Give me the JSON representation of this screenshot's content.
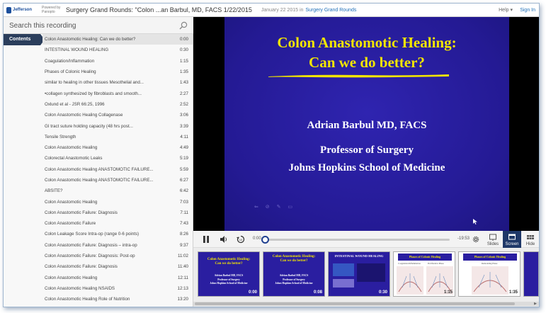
{
  "header": {
    "logo": "Jefferson",
    "powered_by": "Powered by Panopto",
    "title": "Surgery Grand Rounds: \"Colon ...an Barbul, MD, FACS 1/22/2015",
    "date": "January 22 2015 in",
    "folder": "Surgery Grand Rounds",
    "help": "Help",
    "signin": "Sign In"
  },
  "search": {
    "placeholder": "Search this recording"
  },
  "contents_tab": "Contents",
  "toc": [
    {
      "label": "Colon Anastomotic Healing: Can we do better?",
      "time": "0:00"
    },
    {
      "label": "INTESTINAL WOUND HEALING",
      "time": "0:30"
    },
    {
      "label": "Coagulation/Inflammation",
      "time": "1:15"
    },
    {
      "label": "Phases of Colonic Healing",
      "time": "1:35"
    },
    {
      "label": "similar to healing in other tissues Mesothelial and...",
      "time": "1:43"
    },
    {
      "label": "•collagen synthesized by fibroblasts and smooth...",
      "time": "2:27"
    },
    {
      "label": "Oxlund et al - JSR 66:25, 1996",
      "time": "2:52"
    },
    {
      "label": "Colon Anastomotic Healing Collagenase",
      "time": "3:06"
    },
    {
      "label": "GI tract suture holding capacity (48 hrs post...",
      "time": "3:39"
    },
    {
      "label": "Tensile Strength",
      "time": "4:11"
    },
    {
      "label": "Colon Anastomotic Healing",
      "time": "4:49"
    },
    {
      "label": "Colorectal Anastomotic Leaks",
      "time": "5:19"
    },
    {
      "label": "Colon Anastomotic Healing ANASTOMOTIC FAILURE...",
      "time": "5:59"
    },
    {
      "label": "Colon Anastomotic Healing ANASTOMOTIC FAILURE...",
      "time": "6:27"
    },
    {
      "label": "ABSITE?",
      "time": "6:42"
    },
    {
      "label": "Colon Anastomotic Healing",
      "time": "7:03"
    },
    {
      "label": "Colon Anastomotic Failure: Diagnosis",
      "time": "7:11"
    },
    {
      "label": "Colon Anastomotic Failure",
      "time": "7:43"
    },
    {
      "label": "Colon Leakage Score Intra-op (range 0-6 points)",
      "time": "8:26"
    },
    {
      "label": "Colon Anastomotic Failure: Diagnosis – intra-op",
      "time": "9:37"
    },
    {
      "label": "Colon Anastomotic Failure: Diagnosis: Post-op",
      "time": "11:02"
    },
    {
      "label": "Colon Anastomotic Failure: Diagnosis",
      "time": "11:40"
    },
    {
      "label": "Colon Anastomotic Healing",
      "time": "12:11"
    },
    {
      "label": "Colon Anastomotic Healing NSAIDS",
      "time": "12:13"
    },
    {
      "label": "Colon Anastomotic Healing Role of Nutrition",
      "time": "13:20"
    }
  ],
  "slide": {
    "title_line1": "Colon Anastomotic Healing:",
    "title_line2": "Can we do better?",
    "author": "Adrian Barbul MD, FACS",
    "role": "Professor of Surgery",
    "institution": "Johns Hopkins School of Medicine",
    "colors": {
      "background": "#2a1ea0",
      "title": "#f2e500",
      "text": "#ffffff"
    }
  },
  "player": {
    "time_current": "0:00",
    "time_remaining": "-19:53",
    "progress": 0,
    "buttons": {
      "slides": "Slides",
      "screen": "Screen",
      "hide": "Hide"
    }
  },
  "thumbnails": [
    {
      "title1": "Colon Anastomotic Healing:",
      "title2": "Can we do better?",
      "lines": [
        "Adrian Barbul MD, FACS",
        "Professor of Surgery",
        "Johns Hopkins School of Medicine"
      ],
      "time": "0:00"
    },
    {
      "title1": "Colon Anastomotic Healing:",
      "title2": "Can we do better?",
      "lines": [
        "Adrian Barbul MD, FACS",
        "Professor of Surgery",
        "Johns Hopkins School of Medicine"
      ],
      "time": "0:08"
    },
    {
      "title1": "INTESTINAL WOUND HEALING",
      "time": "0:30"
    },
    {
      "title1": "Phases of Colonic Healing",
      "sub1": "Coagulation/Inflammation",
      "sub2": "Proliferative Phase",
      "time": "1:15"
    },
    {
      "title1": "Phases of Colonic Healing",
      "sub1": "Remodeling Phase",
      "time": "1:35"
    }
  ]
}
